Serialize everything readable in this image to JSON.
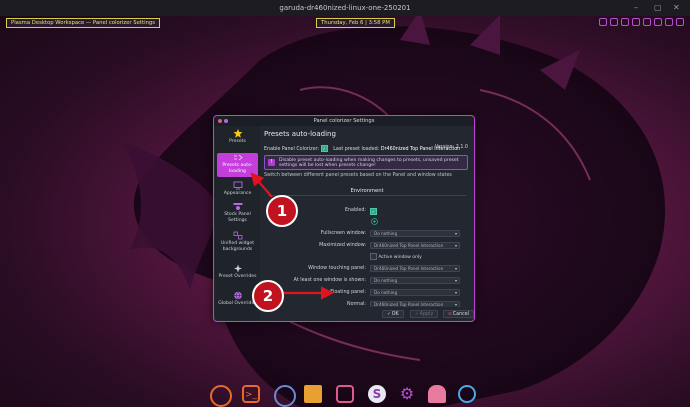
{
  "top_bar": {
    "title": "garuda-dr460nized-linux-one-250201"
  },
  "panel": {
    "workspace_label": "Plasma Desktop Workspace — Panel colorizer Settings",
    "clock_label": "Thursday, Feb 6 | 3:58 PM"
  },
  "window": {
    "title": "Panel colorizer Settings",
    "sidebar": {
      "items": [
        {
          "label": "Presets",
          "icon": "star-icon"
        },
        {
          "label": "Presets auto-loading",
          "icon": "presets-auto-loading-icon"
        },
        {
          "label": "Appearance",
          "icon": "monitor-icon"
        },
        {
          "label": "Stock Panel Settings",
          "icon": "panel-settings-icon"
        },
        {
          "label": "Unified widget backgrounds",
          "icon": "unified-widgets-icon"
        },
        {
          "label": "Preset Overrides",
          "icon": "sparkle-icon"
        },
        {
          "label": "Global Overrides",
          "icon": "globe-icon"
        }
      ]
    },
    "content": {
      "heading": "Presets auto-loading",
      "enable_label": "Enable Panel Colorizer:",
      "last_preset_label": "Last preset loaded:",
      "last_preset_value": "Dr460nized Top Panel Interaction",
      "version_label": "Version: 2.1.0",
      "info_text": "Disable preset auto-loading when making changes to presets, unsaved preset settings will be lost when presets change!",
      "switch_description": "Switch between different panel presets based on the Panel and window states",
      "environment_heading": "Environment",
      "enabled_label": "Enabled:",
      "rows": [
        {
          "label": "Fullscreen window:",
          "value": "Do nothing"
        },
        {
          "label": "Maximized window:",
          "value": "Dr460nized Top Panel Interaction"
        },
        {
          "label": "",
          "value": "Active window only"
        },
        {
          "label": "Window touching panel:",
          "value": "Dr460nized Top Panel Interaction"
        },
        {
          "label": "At least one window is shown:",
          "value": "Do nothing"
        },
        {
          "label": "Floating panel:",
          "value": "Do nothing"
        },
        {
          "label": "Normal:",
          "value": "Dr460nized Top Panel Interaction"
        }
      ]
    },
    "footer": {
      "ok_label": "OK",
      "apply_label": "Apply",
      "cancel_label": "Cancel"
    }
  },
  "callouts": {
    "one": "1",
    "two": "2"
  },
  "colors": {
    "accent": "#c53ddb",
    "callout": "#c1121f",
    "check": "#2aa987"
  },
  "dock": {
    "icons": [
      "garuda-icon",
      "terminal-icon",
      "browser-icon",
      "files-icon",
      "system-monitor-icon",
      "settings-s-icon",
      "gear-icon",
      "ghost-icon",
      "garuda-g-icon"
    ]
  }
}
